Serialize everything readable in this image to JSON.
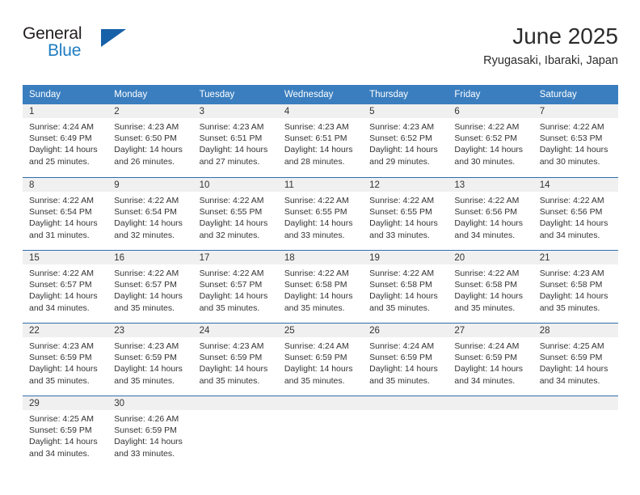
{
  "logo": {
    "word_one": "General",
    "word_two": "Blue",
    "triangle_color": "#1761a8",
    "blue_text_color": "#1f7dc2"
  },
  "header": {
    "title": "June 2025",
    "subtitle": "Ryugasaki, Ibaraki, Japan"
  },
  "calendar": {
    "header_bg": "#3a7ebf",
    "row_border": "#2f6fae",
    "daynum_bg": "#f0f0f0",
    "weekdays": [
      "Sunday",
      "Monday",
      "Tuesday",
      "Wednesday",
      "Thursday",
      "Friday",
      "Saturday"
    ],
    "weeks": [
      [
        {
          "day": "1",
          "sunrise": "Sunrise: 4:24 AM",
          "sunset": "Sunset: 6:49 PM",
          "daylight_1": "Daylight: 14 hours",
          "daylight_2": "and 25 minutes."
        },
        {
          "day": "2",
          "sunrise": "Sunrise: 4:23 AM",
          "sunset": "Sunset: 6:50 PM",
          "daylight_1": "Daylight: 14 hours",
          "daylight_2": "and 26 minutes."
        },
        {
          "day": "3",
          "sunrise": "Sunrise: 4:23 AM",
          "sunset": "Sunset: 6:51 PM",
          "daylight_1": "Daylight: 14 hours",
          "daylight_2": "and 27 minutes."
        },
        {
          "day": "4",
          "sunrise": "Sunrise: 4:23 AM",
          "sunset": "Sunset: 6:51 PM",
          "daylight_1": "Daylight: 14 hours",
          "daylight_2": "and 28 minutes."
        },
        {
          "day": "5",
          "sunrise": "Sunrise: 4:23 AM",
          "sunset": "Sunset: 6:52 PM",
          "daylight_1": "Daylight: 14 hours",
          "daylight_2": "and 29 minutes."
        },
        {
          "day": "6",
          "sunrise": "Sunrise: 4:22 AM",
          "sunset": "Sunset: 6:52 PM",
          "daylight_1": "Daylight: 14 hours",
          "daylight_2": "and 30 minutes."
        },
        {
          "day": "7",
          "sunrise": "Sunrise: 4:22 AM",
          "sunset": "Sunset: 6:53 PM",
          "daylight_1": "Daylight: 14 hours",
          "daylight_2": "and 30 minutes."
        }
      ],
      [
        {
          "day": "8",
          "sunrise": "Sunrise: 4:22 AM",
          "sunset": "Sunset: 6:54 PM",
          "daylight_1": "Daylight: 14 hours",
          "daylight_2": "and 31 minutes."
        },
        {
          "day": "9",
          "sunrise": "Sunrise: 4:22 AM",
          "sunset": "Sunset: 6:54 PM",
          "daylight_1": "Daylight: 14 hours",
          "daylight_2": "and 32 minutes."
        },
        {
          "day": "10",
          "sunrise": "Sunrise: 4:22 AM",
          "sunset": "Sunset: 6:55 PM",
          "daylight_1": "Daylight: 14 hours",
          "daylight_2": "and 32 minutes."
        },
        {
          "day": "11",
          "sunrise": "Sunrise: 4:22 AM",
          "sunset": "Sunset: 6:55 PM",
          "daylight_1": "Daylight: 14 hours",
          "daylight_2": "and 33 minutes."
        },
        {
          "day": "12",
          "sunrise": "Sunrise: 4:22 AM",
          "sunset": "Sunset: 6:55 PM",
          "daylight_1": "Daylight: 14 hours",
          "daylight_2": "and 33 minutes."
        },
        {
          "day": "13",
          "sunrise": "Sunrise: 4:22 AM",
          "sunset": "Sunset: 6:56 PM",
          "daylight_1": "Daylight: 14 hours",
          "daylight_2": "and 34 minutes."
        },
        {
          "day": "14",
          "sunrise": "Sunrise: 4:22 AM",
          "sunset": "Sunset: 6:56 PM",
          "daylight_1": "Daylight: 14 hours",
          "daylight_2": "and 34 minutes."
        }
      ],
      [
        {
          "day": "15",
          "sunrise": "Sunrise: 4:22 AM",
          "sunset": "Sunset: 6:57 PM",
          "daylight_1": "Daylight: 14 hours",
          "daylight_2": "and 34 minutes."
        },
        {
          "day": "16",
          "sunrise": "Sunrise: 4:22 AM",
          "sunset": "Sunset: 6:57 PM",
          "daylight_1": "Daylight: 14 hours",
          "daylight_2": "and 35 minutes."
        },
        {
          "day": "17",
          "sunrise": "Sunrise: 4:22 AM",
          "sunset": "Sunset: 6:57 PM",
          "daylight_1": "Daylight: 14 hours",
          "daylight_2": "and 35 minutes."
        },
        {
          "day": "18",
          "sunrise": "Sunrise: 4:22 AM",
          "sunset": "Sunset: 6:58 PM",
          "daylight_1": "Daylight: 14 hours",
          "daylight_2": "and 35 minutes."
        },
        {
          "day": "19",
          "sunrise": "Sunrise: 4:22 AM",
          "sunset": "Sunset: 6:58 PM",
          "daylight_1": "Daylight: 14 hours",
          "daylight_2": "and 35 minutes."
        },
        {
          "day": "20",
          "sunrise": "Sunrise: 4:22 AM",
          "sunset": "Sunset: 6:58 PM",
          "daylight_1": "Daylight: 14 hours",
          "daylight_2": "and 35 minutes."
        },
        {
          "day": "21",
          "sunrise": "Sunrise: 4:23 AM",
          "sunset": "Sunset: 6:58 PM",
          "daylight_1": "Daylight: 14 hours",
          "daylight_2": "and 35 minutes."
        }
      ],
      [
        {
          "day": "22",
          "sunrise": "Sunrise: 4:23 AM",
          "sunset": "Sunset: 6:59 PM",
          "daylight_1": "Daylight: 14 hours",
          "daylight_2": "and 35 minutes."
        },
        {
          "day": "23",
          "sunrise": "Sunrise: 4:23 AM",
          "sunset": "Sunset: 6:59 PM",
          "daylight_1": "Daylight: 14 hours",
          "daylight_2": "and 35 minutes."
        },
        {
          "day": "24",
          "sunrise": "Sunrise: 4:23 AM",
          "sunset": "Sunset: 6:59 PM",
          "daylight_1": "Daylight: 14 hours",
          "daylight_2": "and 35 minutes."
        },
        {
          "day": "25",
          "sunrise": "Sunrise: 4:24 AM",
          "sunset": "Sunset: 6:59 PM",
          "daylight_1": "Daylight: 14 hours",
          "daylight_2": "and 35 minutes."
        },
        {
          "day": "26",
          "sunrise": "Sunrise: 4:24 AM",
          "sunset": "Sunset: 6:59 PM",
          "daylight_1": "Daylight: 14 hours",
          "daylight_2": "and 35 minutes."
        },
        {
          "day": "27",
          "sunrise": "Sunrise: 4:24 AM",
          "sunset": "Sunset: 6:59 PM",
          "daylight_1": "Daylight: 14 hours",
          "daylight_2": "and 34 minutes."
        },
        {
          "day": "28",
          "sunrise": "Sunrise: 4:25 AM",
          "sunset": "Sunset: 6:59 PM",
          "daylight_1": "Daylight: 14 hours",
          "daylight_2": "and 34 minutes."
        }
      ],
      [
        {
          "day": "29",
          "sunrise": "Sunrise: 4:25 AM",
          "sunset": "Sunset: 6:59 PM",
          "daylight_1": "Daylight: 14 hours",
          "daylight_2": "and 34 minutes."
        },
        {
          "day": "30",
          "sunrise": "Sunrise: 4:26 AM",
          "sunset": "Sunset: 6:59 PM",
          "daylight_1": "Daylight: 14 hours",
          "daylight_2": "and 33 minutes."
        },
        {
          "day": "",
          "sunrise": "",
          "sunset": "",
          "daylight_1": "",
          "daylight_2": ""
        },
        {
          "day": "",
          "sunrise": "",
          "sunset": "",
          "daylight_1": "",
          "daylight_2": ""
        },
        {
          "day": "",
          "sunrise": "",
          "sunset": "",
          "daylight_1": "",
          "daylight_2": ""
        },
        {
          "day": "",
          "sunrise": "",
          "sunset": "",
          "daylight_1": "",
          "daylight_2": ""
        },
        {
          "day": "",
          "sunrise": "",
          "sunset": "",
          "daylight_1": "",
          "daylight_2": ""
        }
      ]
    ]
  }
}
